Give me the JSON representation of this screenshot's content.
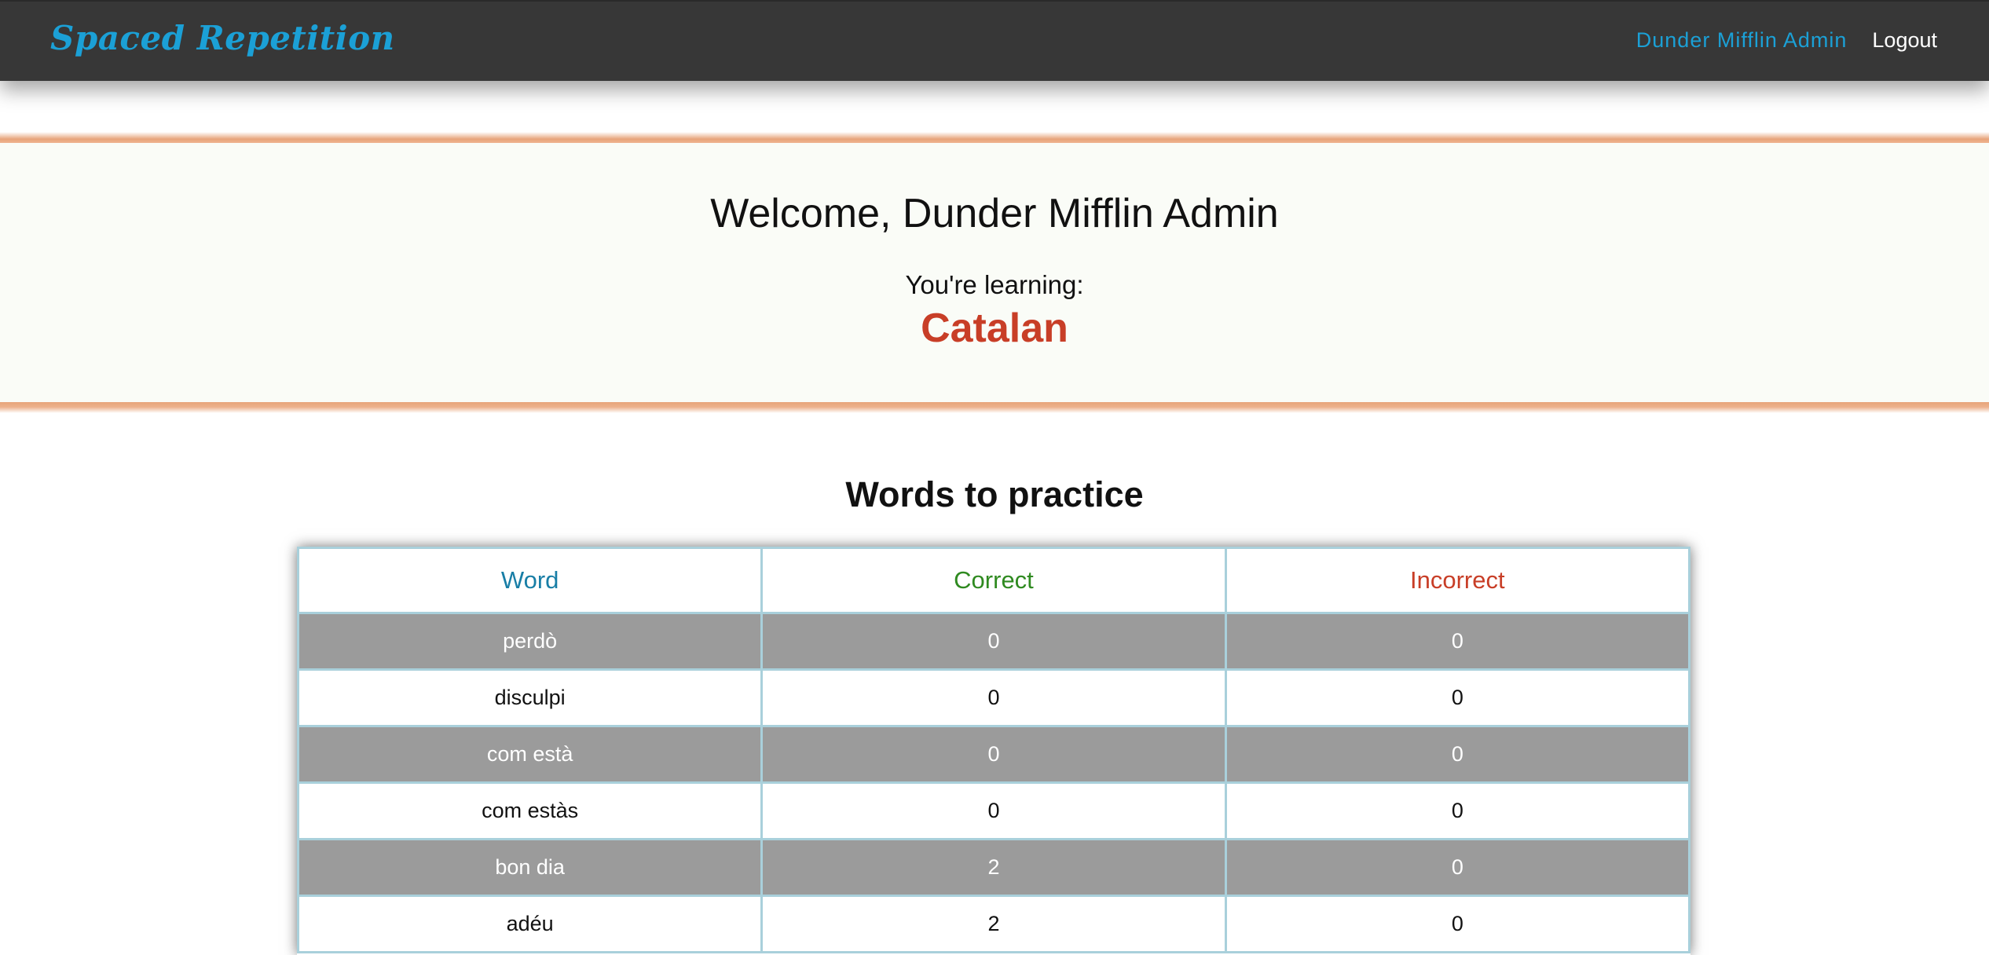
{
  "nav": {
    "brand": "Spaced Repetition",
    "user": "Dunder Mifflin Admin",
    "logout": "Logout"
  },
  "welcome": {
    "title": "Welcome, Dunder Mifflin Admin",
    "learning_label": "You're learning:",
    "language": "Catalan"
  },
  "practice": {
    "title": "Words to practice",
    "headers": [
      "Word",
      "Correct",
      "Incorrect"
    ],
    "rows": [
      {
        "word": "perdò",
        "correct": "0",
        "incorrect": "0"
      },
      {
        "word": "disculpi",
        "correct": "0",
        "incorrect": "0"
      },
      {
        "word": "com està",
        "correct": "0",
        "incorrect": "0"
      },
      {
        "word": "com estàs",
        "correct": "0",
        "incorrect": "0"
      },
      {
        "word": "bon dia",
        "correct": "2",
        "incorrect": "0"
      },
      {
        "word": "adéu",
        "correct": "2",
        "incorrect": "0"
      }
    ]
  },
  "colors": {
    "navbar": "#373737",
    "brand": "#1ba0d6",
    "language": "#c83e27",
    "word_header": "#187ea6",
    "correct_header": "#2f8a20",
    "incorrect_header": "#c83e27",
    "row_alt": "#9b9b9b",
    "accent_line": "#e7a47a"
  }
}
